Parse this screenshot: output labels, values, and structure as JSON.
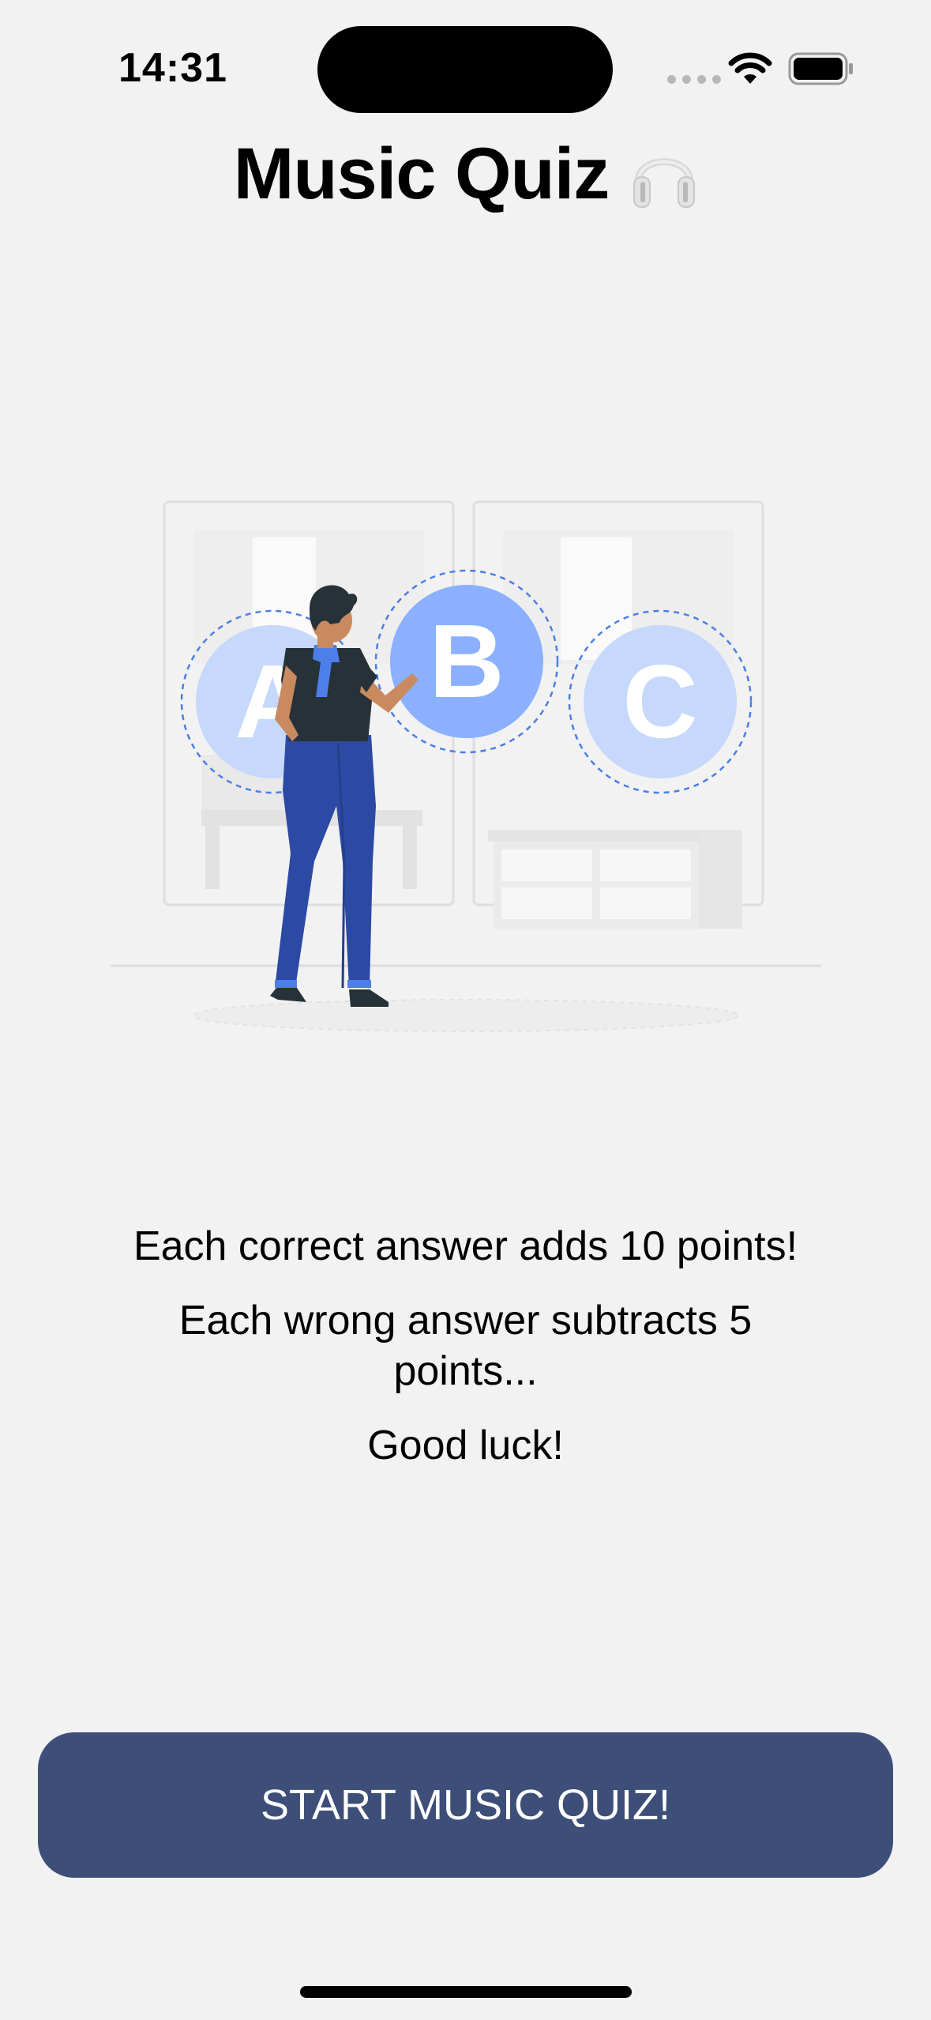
{
  "status_bar": {
    "time": "14:31"
  },
  "header": {
    "title": "Music Quiz",
    "title_icon": "headphones-icon"
  },
  "illustration": {
    "choices": [
      "A",
      "B",
      "C"
    ],
    "colors": {
      "selected_choice": "#8ab0ff",
      "choice": "#c6d8fb",
      "pants": "#2c4aa3",
      "shirt": "#263238",
      "scarf": "#4e7fe8"
    }
  },
  "rules": {
    "line1": "Each correct answer adds 10 points!",
    "line2": "Each wrong answer subtracts 5 points...",
    "line3": "Good luck!"
  },
  "start_button": {
    "label": "START MUSIC QUIZ!",
    "color": "#3d4f78"
  }
}
